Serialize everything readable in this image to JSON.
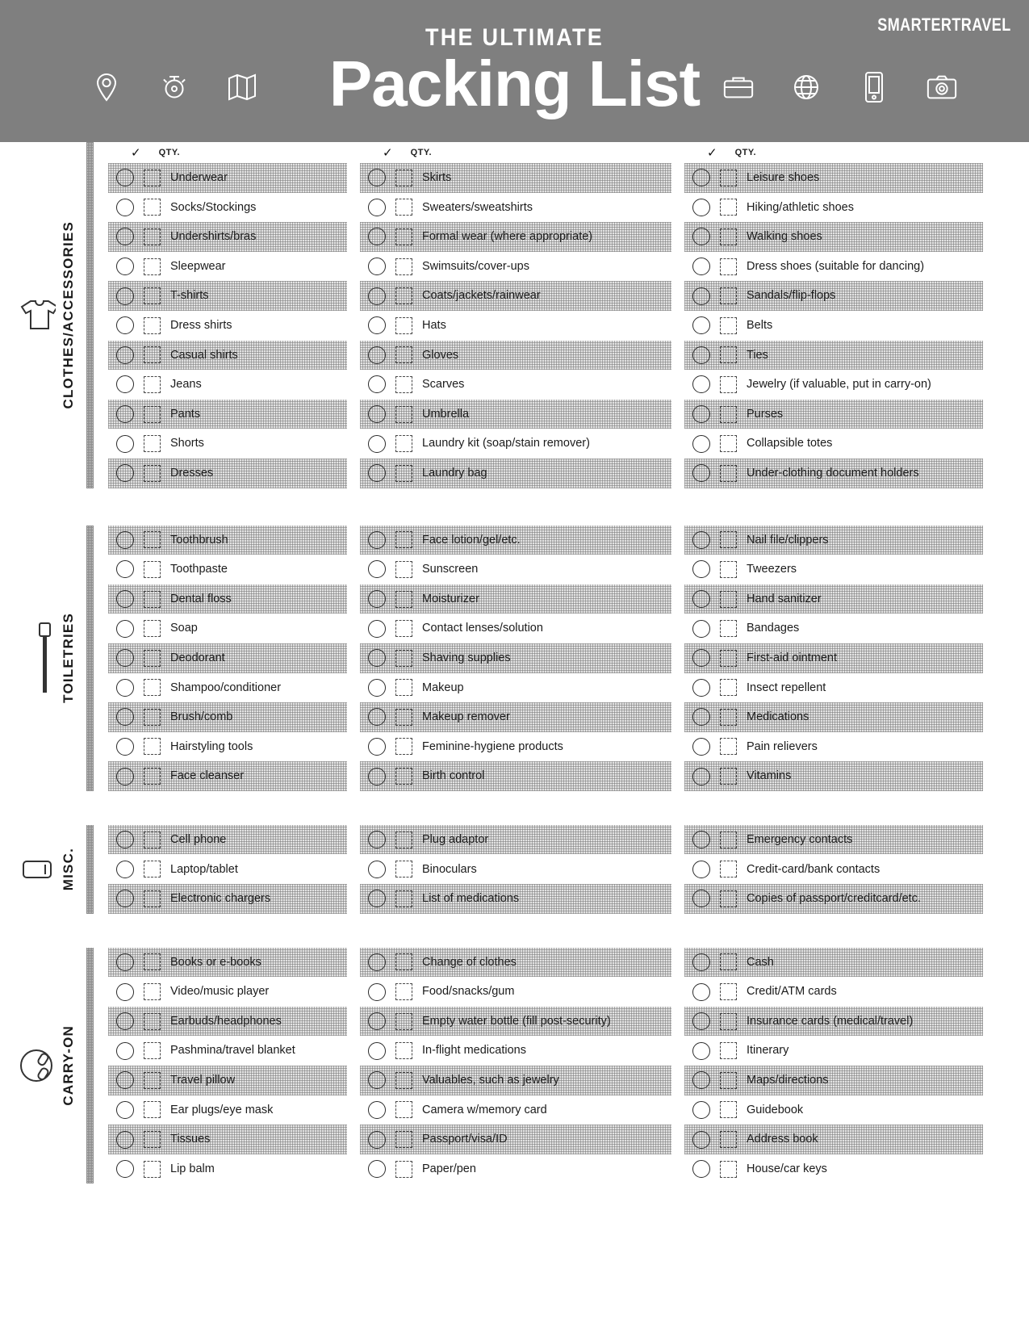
{
  "header": {
    "brand": "SMARTERTRAVEL",
    "title_sub": "THE ULTIMATE",
    "title_main": "Packing List",
    "background_color": "#7f7f7f",
    "text_color": "#ffffff",
    "left_icons": [
      "map-pin-icon",
      "compass-icon",
      "folded-map-icon"
    ],
    "right_icons": [
      "suitcase-icon",
      "globe-icon",
      "smartphone-icon",
      "camera-icon"
    ]
  },
  "column_header": {
    "check_glyph": "✓",
    "qty_label": "QTY."
  },
  "sections": [
    {
      "id": "clothes",
      "label": "CLOTHES/ACCESSORIES",
      "icon": "tshirt-icon",
      "columns": [
        [
          "Underwear",
          "Socks/Stockings",
          "Undershirts/bras",
          "Sleepwear",
          "T-shirts",
          "Dress shirts",
          "Casual shirts",
          "Jeans",
          "Pants",
          "Shorts",
          "Dresses"
        ],
        [
          "Skirts",
          "Sweaters/sweatshirts",
          "Formal wear (where appropriate)",
          "Swimsuits/cover-ups",
          "Coats/jackets/rainwear",
          "Hats",
          "Gloves",
          "Scarves",
          "Umbrella",
          "Laundry kit (soap/stain remover)",
          "Laundry bag"
        ],
        [
          "Leisure shoes",
          "Hiking/athletic shoes",
          "Walking shoes",
          "Dress shoes (suitable for dancing)",
          "Sandals/flip-flops",
          "Belts",
          "Ties",
          "Jewelry (if valuable, put in carry-on)",
          "Purses",
          "Collapsible totes",
          "Under-clothing document holders"
        ]
      ]
    },
    {
      "id": "toiletries",
      "label": "TOILETRIES",
      "icon": "toothbrush-icon",
      "columns": [
        [
          "Toothbrush",
          "Toothpaste",
          "Dental floss",
          "Soap",
          "Deodorant",
          "Shampoo/conditioner",
          "Brush/comb",
          "Hairstyling tools",
          "Face cleanser"
        ],
        [
          "Face lotion/gel/etc.",
          "Sunscreen",
          "Moisturizer",
          "Contact lenses/solution",
          "Shaving supplies",
          "Makeup",
          "Makeup remover",
          "Feminine-hygiene products",
          "Birth control"
        ],
        [
          "Nail file/clippers",
          "Tweezers",
          "Hand sanitizer",
          "Bandages",
          "First-aid ointment",
          "Insect repellent",
          "Medications",
          "Pain relievers",
          "Vitamins"
        ]
      ]
    },
    {
      "id": "misc",
      "label": "MISC.",
      "icon": "device-icon",
      "columns": [
        [
          "Cell phone",
          "Laptop/tablet",
          "Electronic chargers"
        ],
        [
          "Plug adaptor",
          "Binoculars",
          "List of medications"
        ],
        [
          "Emergency contacts",
          "Credit-card/bank contacts",
          "Copies of passport/creditcard/etc."
        ]
      ]
    },
    {
      "id": "carryon",
      "label": "CARRY-ON",
      "icon": "headphones-icon",
      "columns": [
        [
          "Books or e-books",
          "Video/music player",
          "Earbuds/headphones",
          "Pashmina/travel blanket",
          "Travel pillow",
          "Ear plugs/eye mask",
          "Tissues",
          "Lip balm"
        ],
        [
          "Change of clothes",
          "Food/snacks/gum",
          "Empty water bottle (fill post-security)",
          "In-flight medications",
          "Valuables, such as jewelry",
          "Camera w/memory card",
          "Passport/visa/ID",
          "Paper/pen"
        ],
        [
          "Cash",
          "Credit/ATM cards",
          "Insurance cards (medical/travel)",
          "Itinerary",
          "Maps/directions",
          "Guidebook",
          "Address book",
          "House/car keys"
        ]
      ]
    }
  ]
}
